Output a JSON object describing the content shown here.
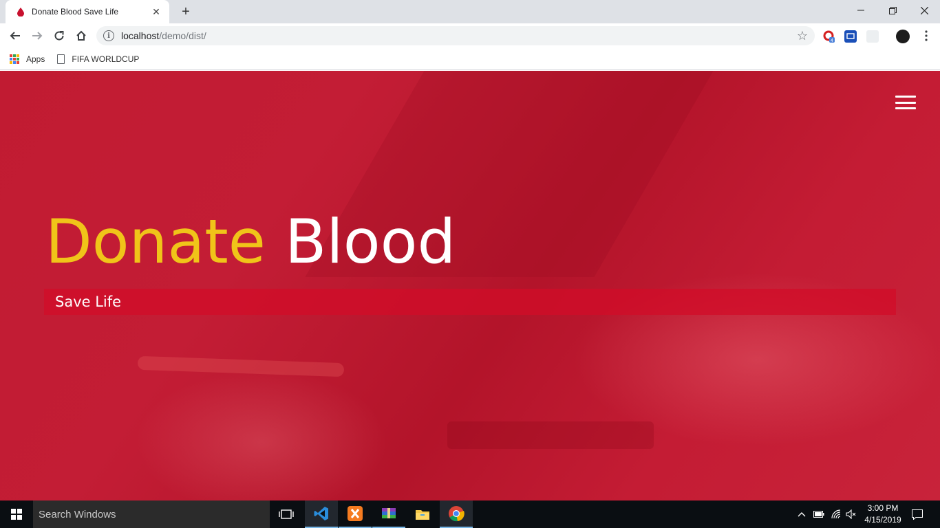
{
  "browser": {
    "tab": {
      "title": "Donate Blood Save Life",
      "close_icon": "close-icon",
      "favicon": "blood-drop-icon"
    },
    "new_tab_label": "+",
    "url": {
      "host": "localhost",
      "path": "/demo/dist/"
    },
    "bookmarks": [
      {
        "label": "Apps",
        "icon": "apps-grid-icon"
      },
      {
        "label": "FIFA WORLDCUP",
        "icon": "page-icon"
      }
    ]
  },
  "page": {
    "headline": {
      "accent": "Donate",
      "main": "Blood"
    },
    "subtitle": "Save Life",
    "colors": {
      "accent": "#f0c419",
      "hero_red": "#c11b32",
      "band_red": "#d20c28"
    }
  },
  "taskbar": {
    "search_placeholder": "Search Windows",
    "clock": {
      "time": "3:00 PM",
      "date": "4/15/2019"
    }
  }
}
